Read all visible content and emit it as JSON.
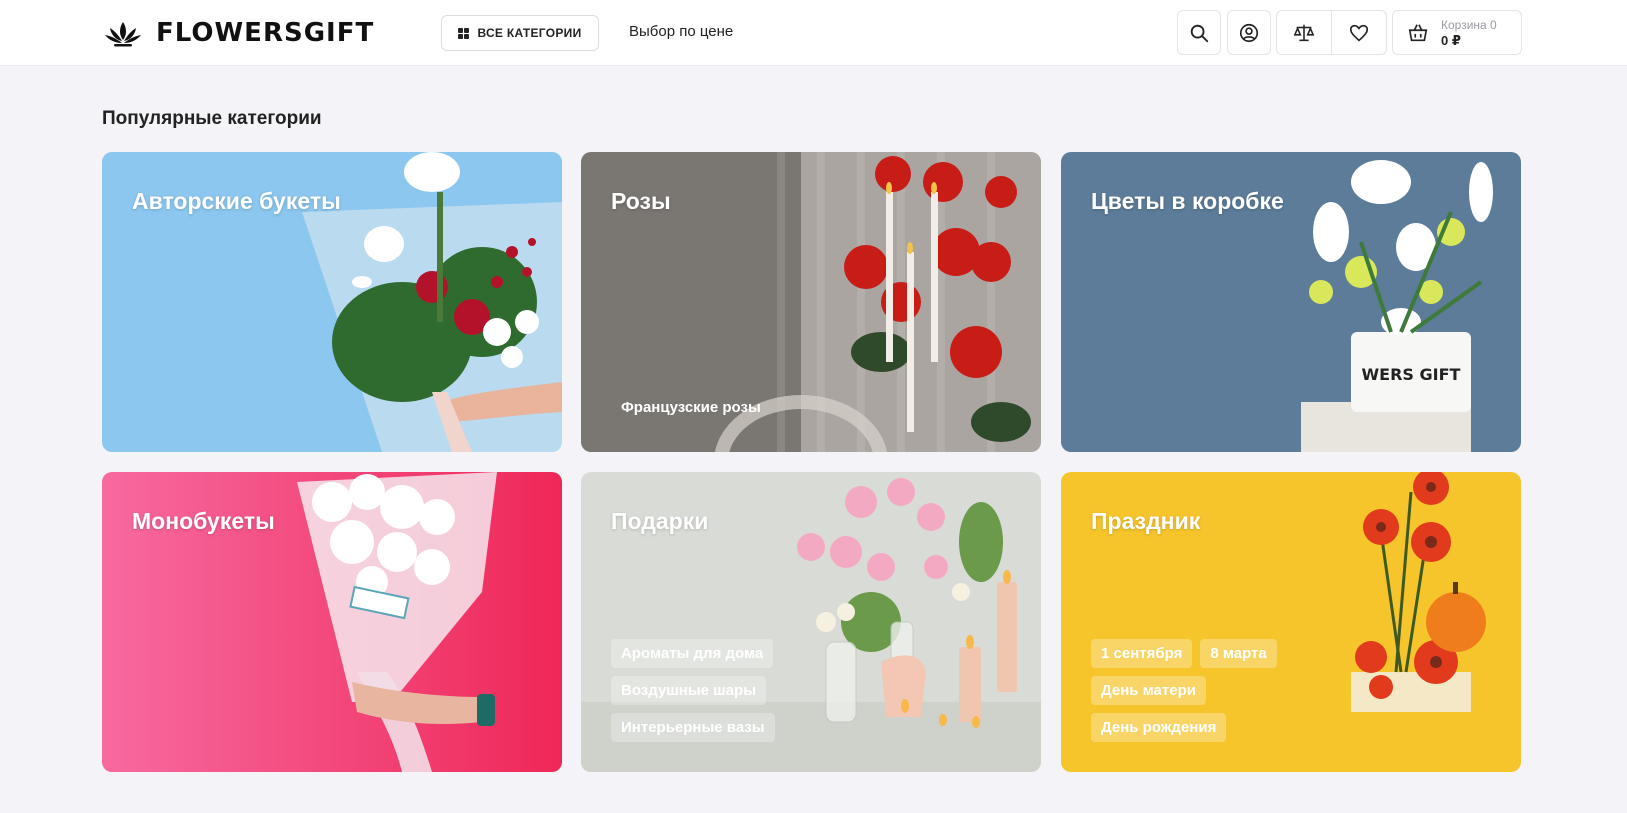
{
  "header": {
    "logo_text": "FLOWERSGIFT",
    "categories_button": "ВСЕ КАТЕГОРИИ",
    "price_link": "Выбор по цене",
    "cart_label": "Корзина 0",
    "cart_sum": "0 ₽",
    "icons": [
      "search-icon",
      "user-icon",
      "compare-icon",
      "heart-icon",
      "basket-icon"
    ]
  },
  "section_title": "Популярные категории",
  "tiles": [
    {
      "title": "Авторские букеты",
      "tags": []
    },
    {
      "title": "Розы",
      "tags": [
        "Французские розы"
      ]
    },
    {
      "title": "Цветы в коробке",
      "tags": []
    },
    {
      "title": "Монобукеты",
      "tags": []
    },
    {
      "title": "Подарки",
      "tags": [
        "Ароматы для дома",
        "Воздушные шары",
        "Интерьерные вазы"
      ]
    },
    {
      "title": "Праздник",
      "tags": [
        "1 сентября",
        "8 марта",
        "День матери",
        "День рождения"
      ]
    }
  ],
  "box_print": "WERS GIFT",
  "colors": {
    "page_bg": "#f4f4f8",
    "tile_sky": "#8cc7ef",
    "tile_grey": "#7a7672",
    "tile_slate": "#5c7c99",
    "tile_pink": "#f0487e",
    "tile_mist": "#d9dcd6",
    "tile_yellow": "#f6c52c"
  }
}
